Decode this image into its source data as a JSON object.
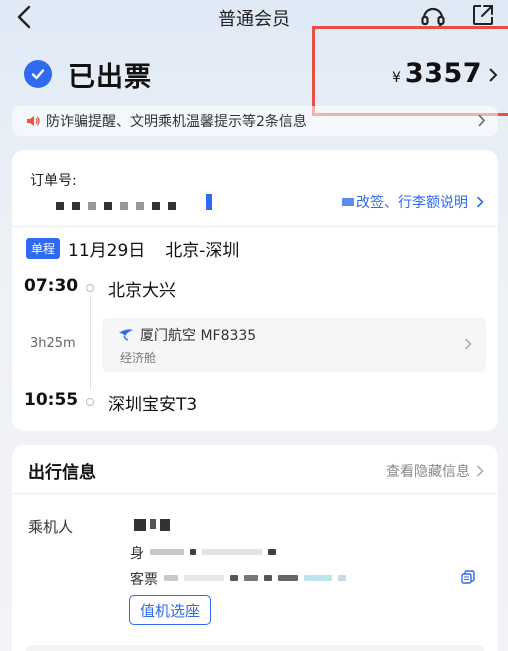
{
  "nav": {
    "title": "普通会员"
  },
  "status": {
    "text": "已出票"
  },
  "price": {
    "currency": "¥",
    "amount": "3357"
  },
  "notice": {
    "text": "防诈骗提醒、文明乘机温馨提示等2条信息"
  },
  "order": {
    "label": "订单号:",
    "change_link": "改签、行李额说明"
  },
  "trip": {
    "badge": "单程",
    "date": "11月29日",
    "route": "北京-深圳",
    "departure": {
      "time": "07:30",
      "airport": "北京大兴"
    },
    "arrival": {
      "time": "10:55",
      "airport": "深圳宝安T3"
    },
    "duration": "3h25m",
    "airline": "厦门航空 MF8335",
    "cabin": "经济舱"
  },
  "travel_info": {
    "title": "出行信息",
    "hidden_link": "查看隐藏信息",
    "passenger_label": "乘机人",
    "id_label": "身",
    "ticket_label": "客票",
    "checkin_button": "值机选座"
  },
  "colors": {
    "accent": "#2f6af0",
    "highlight_border": "#e25240"
  },
  "icons": {
    "back": "chevron-left-icon",
    "service": "customer-service-icon",
    "share": "share-icon",
    "status": "check-circle-icon",
    "notice": "speaker-icon",
    "airline": "airline-logo-icon",
    "copy": "copy-icon"
  }
}
